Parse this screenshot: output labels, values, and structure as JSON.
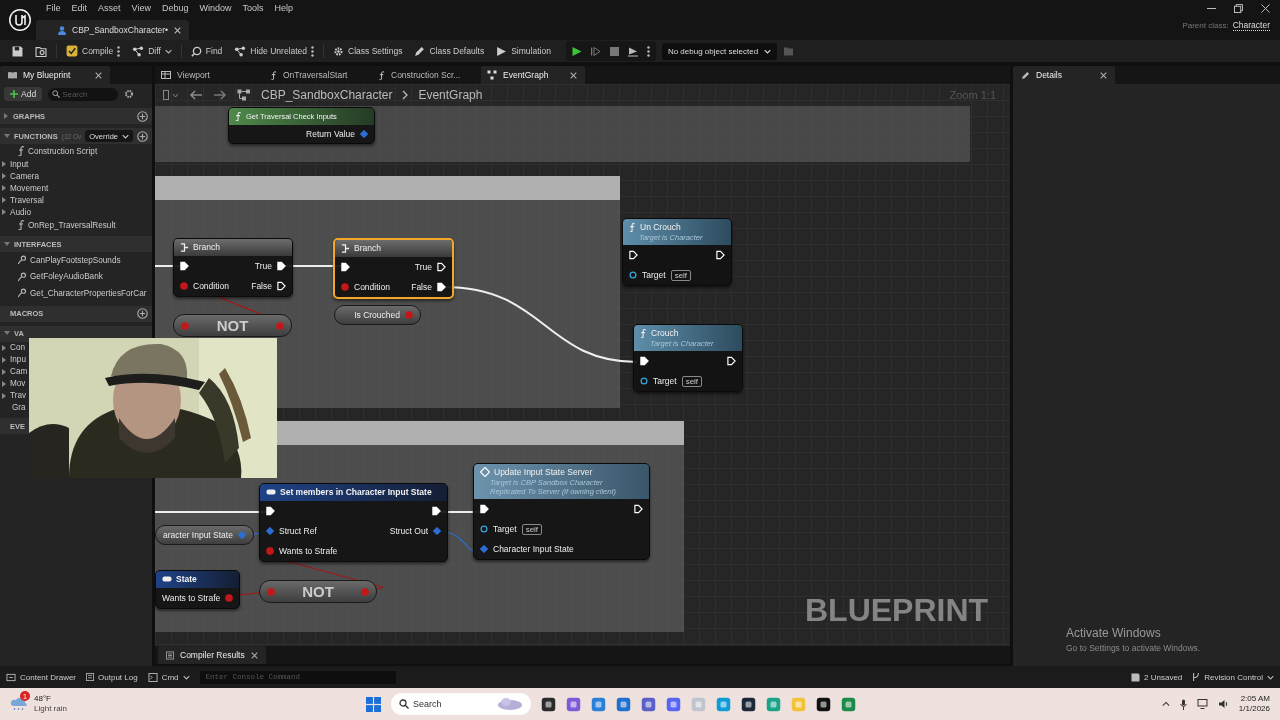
{
  "menu": [
    "File",
    "Edit",
    "Asset",
    "View",
    "Debug",
    "Window",
    "Tools",
    "Help"
  ],
  "document_tab": {
    "title": "CBP_SandboxCharacter•"
  },
  "parent_class": {
    "label": "Parent class:",
    "value": "Character"
  },
  "toolbar": {
    "items": [
      {
        "label": "Compile",
        "kind": "compile"
      },
      {
        "label": "Diff",
        "kind": "diff"
      },
      {
        "label": "Find",
        "kind": "find"
      },
      {
        "label": "Hide Unrelated",
        "kind": "hide"
      },
      {
        "label": "Class Settings",
        "kind": "settings"
      },
      {
        "label": "Class Defaults",
        "kind": "defaults"
      },
      {
        "label": "Simulation",
        "kind": "simulation"
      }
    ],
    "debug_object": "No debug object selected"
  },
  "my_blueprint": {
    "title": "My Blueprint",
    "add": "Add",
    "search_placeholder": "Search",
    "sections": [
      {
        "title": "GRAPHS",
        "expanded": false,
        "add": true
      },
      {
        "title": "FUNCTIONS",
        "note": "(32 Ov",
        "override": "Override",
        "expanded": true,
        "add": true,
        "items": [
          {
            "label": "Construction Script",
            "kind": "function"
          },
          {
            "label": "Input",
            "kind": "category",
            "expanded": false
          },
          {
            "label": "Camera",
            "kind": "category",
            "expanded": false
          },
          {
            "label": "Movement",
            "kind": "category",
            "expanded": false
          },
          {
            "label": "Traversal",
            "kind": "category",
            "expanded": false
          },
          {
            "label": "Audio",
            "kind": "category",
            "expanded": false
          },
          {
            "label": "OnRep_TraversalResult",
            "kind": "function"
          }
        ]
      },
      {
        "title": "INTERFACES",
        "expanded": true,
        "items": [
          {
            "label": "CanPlayFootstepSounds",
            "kind": "interface"
          },
          {
            "label": "GetFoleyAudioBank",
            "kind": "interface"
          },
          {
            "label": "Get_CharacterPropertiesForCar",
            "kind": "interface"
          }
        ]
      },
      {
        "title": "MACROS",
        "add": true
      },
      {
        "title": "VA",
        "expanded": true,
        "items": [
          {
            "label": "Con",
            "kind": "category",
            "expanded": false
          },
          {
            "label": "Inpu",
            "kind": "category",
            "expanded": false
          },
          {
            "label": "Cam",
            "kind": "category",
            "expanded": false
          },
          {
            "label": "Mov",
            "kind": "category",
            "expanded": false
          },
          {
            "label": "Trav",
            "kind": "category",
            "expanded": false
          },
          {
            "label": "Gra",
            "kind": "variable"
          }
        ]
      },
      {
        "title": "EVE"
      }
    ]
  },
  "editor_tabs": [
    {
      "label": "Viewport",
      "kind": "viewport",
      "selected": false
    },
    {
      "label": "OnTraversalStart",
      "kind": "function",
      "selected": false
    },
    {
      "label": "Construction Scr...",
      "kind": "function",
      "selected": false
    },
    {
      "label": "EventGraph",
      "kind": "graph",
      "selected": true
    }
  ],
  "graph": {
    "breadcrumb": [
      "CBP_SandboxCharacter",
      "EventGraph"
    ],
    "zoom": "Zoom 1:1",
    "watermark": "BLUEPRINT",
    "nodes": [
      {
        "kind": "pure-function",
        "title": "Get Traversal Check Inputs",
        "selected": false,
        "rows": [
          {
            "right": {
              "label": "Return Value",
              "kind": "struct",
              "connected": true
            }
          }
        ]
      },
      {
        "kind": "flow",
        "title": "Branch",
        "selected": false,
        "rows": [
          {
            "left": {
              "kind": "exec",
              "connected": true
            },
            "right": {
              "label": "True",
              "kind": "exec",
              "connected": true
            }
          },
          {
            "left": {
              "label": "Condition",
              "kind": "bool",
              "connected": true
            },
            "right": {
              "label": "False",
              "kind": "exec",
              "connected": false
            }
          }
        ]
      },
      {
        "kind": "flow",
        "title": "Branch",
        "selected": true,
        "rows": [
          {
            "left": {
              "kind": "exec",
              "connected": true
            },
            "right": {
              "label": "True",
              "kind": "exec",
              "connected": false
            }
          },
          {
            "left": {
              "label": "Condition",
              "kind": "bool",
              "connected": true
            },
            "right": {
              "label": "False",
              "kind": "exec",
              "connected": true
            }
          }
        ]
      },
      {
        "kind": "operator",
        "title": "NOT",
        "selected": false,
        "rows": [
          {
            "left": {
              "kind": "bool",
              "connected": true
            },
            "right": {
              "kind": "bool",
              "connected": true
            }
          }
        ]
      },
      {
        "kind": "variable",
        "title": "Is Crouched",
        "selected": false,
        "rows": [
          {
            "right": {
              "kind": "bool",
              "connected": true
            }
          }
        ]
      },
      {
        "kind": "function",
        "title": "Un Crouch",
        "subtitle": [
          "Target is Character"
        ],
        "selected": false,
        "rows": [
          {
            "left": {
              "kind": "exec",
              "connected": false
            },
            "right": {
              "kind": "exec",
              "connected": false
            }
          },
          {
            "left": {
              "label": "Target",
              "kind": "object",
              "default": "self",
              "connected": false
            }
          }
        ]
      },
      {
        "kind": "function",
        "title": "Crouch",
        "subtitle": [
          "Target is Character"
        ],
        "selected": false,
        "rows": [
          {
            "left": {
              "kind": "exec",
              "connected": true
            },
            "right": {
              "kind": "exec",
              "connected": false
            }
          },
          {
            "left": {
              "label": "Target",
              "kind": "object",
              "default": "self",
              "connected": false
            }
          }
        ]
      },
      {
        "kind": "variable",
        "title": "aracter Input State",
        "selected": false,
        "rows": [
          {
            "right": {
              "kind": "struct",
              "connected": true
            }
          }
        ]
      },
      {
        "kind": "struct",
        "title": "Set members in Character Input State",
        "selected": false,
        "rows": [
          {
            "left": {
              "kind": "exec",
              "connected": true
            },
            "right": {
              "kind": "exec",
              "connected": true
            }
          },
          {
            "left": {
              "label": "Struct Ref",
              "kind": "struct",
              "connected": true
            },
            "right": {
              "label": "Struct Out",
              "kind": "struct",
              "connected": true
            }
          },
          {
            "left": {
              "label": "Wants to Strafe",
              "kind": "bool",
              "connected": true
            }
          }
        ]
      },
      {
        "kind": "struct",
        "title": "State",
        "selected": false,
        "rows": [
          {
            "right": {
              "label": "Wants to Strafe",
              "kind": "bool",
              "connected": true
            }
          }
        ]
      },
      {
        "kind": "operator",
        "title": "NOT",
        "selected": false,
        "rows": [
          {
            "left": {
              "kind": "bool",
              "connected": true
            },
            "right": {
              "kind": "bool",
              "connected": true
            }
          }
        ]
      },
      {
        "kind": "remote",
        "title": "Update Input State Server",
        "subtitle": [
          "Target is CBP Sandbox Character",
          "Replicated To Server (if owning client)"
        ],
        "selected": false,
        "rows": [
          {
            "left": {
              "kind": "exec",
              "connected": true
            },
            "right": {
              "kind": "exec",
              "connected": false
            }
          },
          {
            "left": {
              "label": "Target",
              "kind": "object",
              "default": "self",
              "connected": false
            }
          },
          {
            "left": {
              "label": "Character Input State",
              "kind": "struct",
              "connected": true
            }
          }
        ]
      }
    ]
  },
  "details": {
    "title": "Details"
  },
  "activation": {
    "title": "Activate Windows",
    "text": "Go to Settings to activate Windows."
  },
  "bottom_tabs": [
    "Compiler Results"
  ],
  "status_bar": {
    "content_drawer": "Content Drawer",
    "output_log": "Output Log",
    "cmd": "Cmd",
    "console_placeholder": "Enter Console Command",
    "unsaved": "2 Unsaved",
    "revision": "Revision Control"
  },
  "taskbar": {
    "weather_badge": "1",
    "temperature": "48°F",
    "condition": "Light rain",
    "search_placeholder": "Search",
    "time": "2:05 AM",
    "date": "1/1/2026"
  }
}
